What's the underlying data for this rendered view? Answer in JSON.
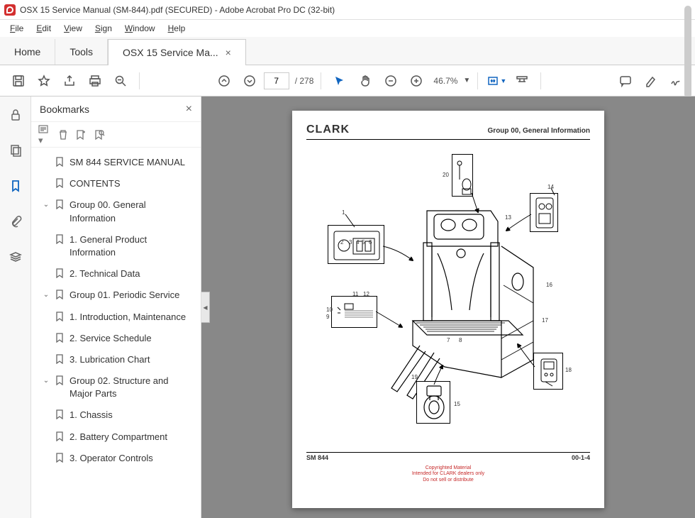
{
  "window": {
    "title": "OSX 15 Service Manual (SM-844).pdf (SECURED) - Adobe Acrobat Pro DC (32-bit)"
  },
  "menubar": {
    "file": "File",
    "edit": "Edit",
    "view": "View",
    "sign": "Sign",
    "window": "Window",
    "help": "Help"
  },
  "tabs": {
    "home": "Home",
    "tools": "Tools",
    "doc": "OSX 15 Service Ma..."
  },
  "toolbar": {
    "page_current": "7",
    "page_total": "/ 278",
    "zoom": "46.7%"
  },
  "bookmarks": {
    "title": "Bookmarks",
    "items": [
      {
        "label": "SM 844 SERVICE MANUAL",
        "level": 1,
        "exp": ""
      },
      {
        "label": "CONTENTS",
        "level": 1,
        "exp": ""
      },
      {
        "label": "Group 00. General Information",
        "level": 1,
        "exp": "v"
      },
      {
        "label": "1. General Product Information",
        "level": 2,
        "exp": ""
      },
      {
        "label": "2. Technical Data",
        "level": 2,
        "exp": ""
      },
      {
        "label": "Group 01. Periodic Service",
        "level": 1,
        "exp": "v"
      },
      {
        "label": "1. Introduction, Maintenance",
        "level": 2,
        "exp": ""
      },
      {
        "label": "2. Service Schedule",
        "level": 2,
        "exp": ""
      },
      {
        "label": "3. Lubrication Chart",
        "level": 2,
        "exp": ""
      },
      {
        "label": "Group 02. Structure and Major Parts",
        "level": 1,
        "exp": "v"
      },
      {
        "label": "1. Chassis",
        "level": 2,
        "exp": ""
      },
      {
        "label": "2. Battery Compartment",
        "level": 2,
        "exp": ""
      },
      {
        "label": "3. Operator Controls",
        "level": 2,
        "exp": ""
      }
    ]
  },
  "doc": {
    "brand": "CLARK",
    "section": "Group 00, General Information",
    "footer_left": "SM 844",
    "footer_right": "00-1-4",
    "copyright1": "Copyrighted Material",
    "copyright2": "Intended for CLARK dealers only",
    "copyright3": "Do not sell or distribute",
    "callouts": {
      "c1": "1",
      "c2": "2",
      "c3": "3",
      "c4": "4",
      "c5": "5",
      "c6": "6",
      "c7": "7",
      "c8": "8",
      "c9": "9",
      "c10": "10",
      "c11": "11",
      "c12": "12",
      "c13": "13",
      "c14": "14",
      "c15": "15",
      "c16": "16",
      "c17": "17",
      "c18": "18",
      "c19": "19",
      "c20": "20"
    }
  }
}
